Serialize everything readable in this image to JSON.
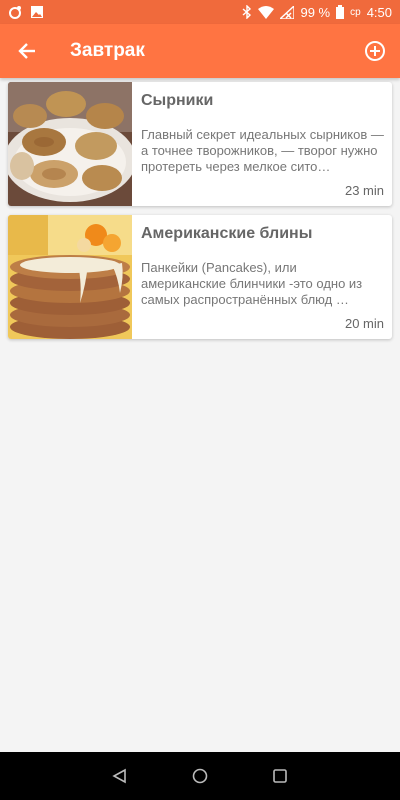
{
  "status_bar": {
    "battery_percent": "99 %",
    "day": "ср",
    "time": "4:50"
  },
  "app_bar": {
    "title": "Завтрак"
  },
  "recipes": [
    {
      "title": "Сырники",
      "description": "Главный секрет идеальных сырников — а точнее творожников, — творог нужно протереть через мелкое сито…",
      "time": "23 min",
      "image": "syrniki-photo"
    },
    {
      "title": "Американские блины",
      "description": "Панкейки (Pancakes), или американские блинчики -это одно из самых распространённых блюд …",
      "time": "20 min",
      "image": "pancakes-photo"
    }
  ],
  "colors": {
    "status_bar": "#f06a3c",
    "app_bar": "#ff7442",
    "background": "#f4f4f4"
  }
}
